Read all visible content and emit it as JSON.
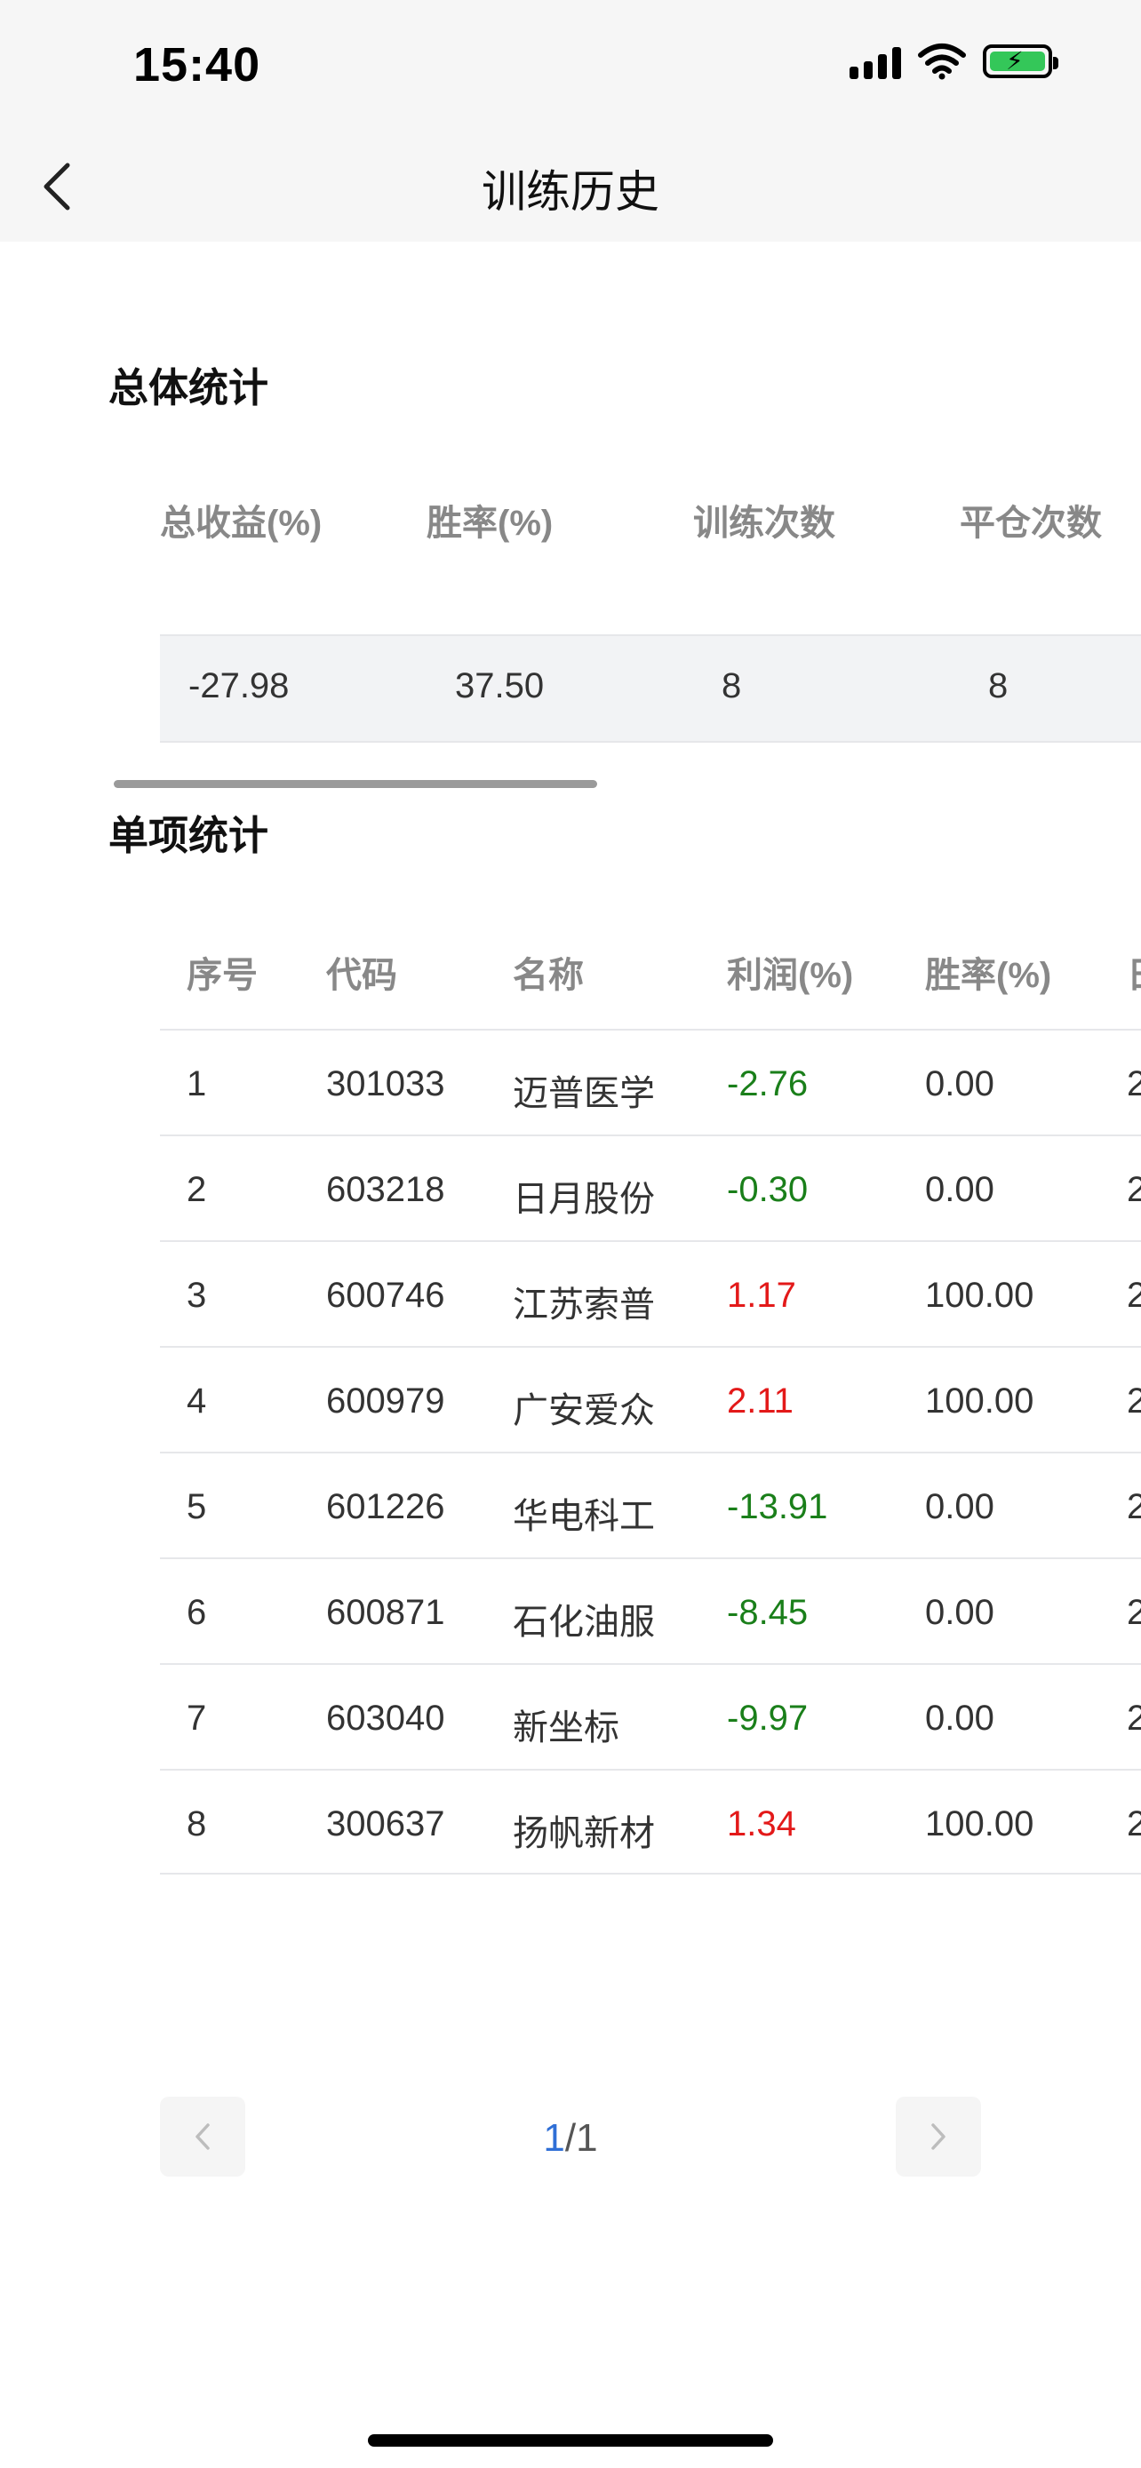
{
  "status": {
    "time": "15:40"
  },
  "nav": {
    "title": "训练历史",
    "back": "返回"
  },
  "overall": {
    "title": "总体统计",
    "headers": [
      "总收益(%)",
      "胜率(%)",
      "训练次数",
      "平仓次数"
    ],
    "values": [
      "-27.98",
      "37.50",
      "8",
      "8"
    ]
  },
  "single": {
    "title": "单项统计",
    "headers": [
      "序号",
      "代码",
      "名称",
      "利润(%)",
      "胜率(%)",
      "日"
    ],
    "rows": [
      [
        "1",
        "301033",
        "迈普医学",
        "-2.76",
        "0.00",
        "2"
      ],
      [
        "2",
        "603218",
        "日月股份",
        "-0.30",
        "0.00",
        "2"
      ],
      [
        "3",
        "600746",
        "江苏索普",
        "1.17",
        "100.00",
        "2"
      ],
      [
        "4",
        "600979",
        "广安爱众",
        "2.11",
        "100.00",
        "2"
      ],
      [
        "5",
        "601226",
        "华电科工",
        "-13.91",
        "0.00",
        "2"
      ],
      [
        "6",
        "600871",
        "石化油服",
        "-8.45",
        "0.00",
        "2"
      ],
      [
        "7",
        "603040",
        "新坐标",
        "-9.97",
        "0.00",
        "2"
      ],
      [
        "8",
        "300637",
        "扬帆新材",
        "1.34",
        "100.00",
        "2"
      ]
    ]
  },
  "pager": {
    "current": "1",
    "separator": "/",
    "total": "1"
  },
  "colors": {
    "negative": "#1a7f1a",
    "positive": "#e31919",
    "accent": "#2f6fd6"
  }
}
